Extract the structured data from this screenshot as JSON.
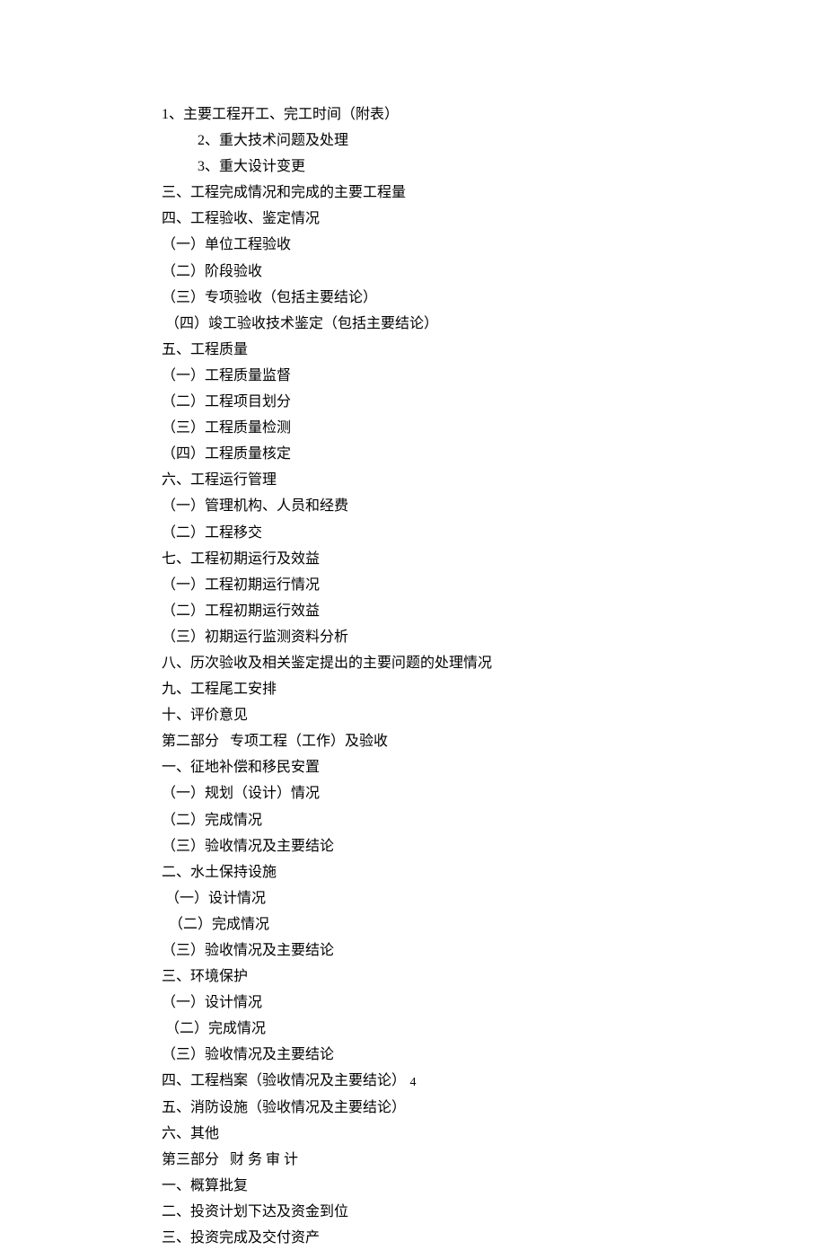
{
  "lines": [
    {
      "text": "1、主要工程开工、完工时间（附表）",
      "indent": 0
    },
    {
      "text": "2、重大技术问题及处理",
      "indent": 1
    },
    {
      "text": "3、重大设计变更",
      "indent": 1
    },
    {
      "text": "三、工程完成情况和完成的主要工程量",
      "indent": 0
    },
    {
      "text": "四、工程验收、鉴定情况",
      "indent": 0
    },
    {
      "text": "（一）单位工程验收",
      "indent": 0
    },
    {
      "text": "（二）阶段验收",
      "indent": 0
    },
    {
      "text": "（三）专项验收（包括主要结论）",
      "indent": 0
    },
    {
      "text": " （四）竣工验收技术鉴定（包括主要结论）",
      "indent": 0
    },
    {
      "text": "五、工程质量",
      "indent": 0
    },
    {
      "text": "（一）工程质量监督",
      "indent": 0
    },
    {
      "text": "（二）工程项目划分",
      "indent": 0
    },
    {
      "text": "（三）工程质量检测",
      "indent": 0
    },
    {
      "text": "（四）工程质量核定",
      "indent": 0
    },
    {
      "text": "六、工程运行管理",
      "indent": 0
    },
    {
      "text": "（一）管理机构、人员和经费",
      "indent": 0
    },
    {
      "text": "（二）工程移交",
      "indent": 0
    },
    {
      "text": "七、工程初期运行及效益",
      "indent": 0
    },
    {
      "text": "（一）工程初期运行情况",
      "indent": 0
    },
    {
      "text": "（二）工程初期运行效益",
      "indent": 0
    },
    {
      "text": "（三）初期运行监测资料分析",
      "indent": 0
    },
    {
      "text": "八、历次验收及相关鉴定提出的主要问题的处理情况",
      "indent": 0
    },
    {
      "text": "九、工程尾工安排",
      "indent": 0
    },
    {
      "text": "十、评价意见",
      "indent": 0
    },
    {
      "text": "第二部分   专项工程（工作）及验收",
      "indent": 0
    },
    {
      "text": "一、征地补偿和移民安置",
      "indent": 0
    },
    {
      "text": "（一）规划（设计）情况",
      "indent": 0
    },
    {
      "text": "（二）完成情况",
      "indent": 0
    },
    {
      "text": "（三）验收情况及主要结论",
      "indent": 0
    },
    {
      "text": "二、水土保持设施",
      "indent": 0
    },
    {
      "text": " （一）设计情况",
      "indent": 0
    },
    {
      "text": "  （二）完成情况",
      "indent": 0
    },
    {
      "text": "（三）验收情况及主要结论",
      "indent": 0
    },
    {
      "text": "三、环境保护",
      "indent": 0
    },
    {
      "text": "（一）设计情况",
      "indent": 0
    },
    {
      "text": " （二）完成情况",
      "indent": 0
    },
    {
      "text": "（三）验收情况及主要结论",
      "indent": 0
    },
    {
      "text": "四、工程档案（验收情况及主要结论）",
      "indent": 0
    },
    {
      "text": "五、消防设施（验收情况及主要结论）",
      "indent": 0
    },
    {
      "text": "六、其他",
      "indent": 0
    },
    {
      "text": "第三部分   财 务 审 计",
      "indent": 0
    },
    {
      "text": "一、概算批复",
      "indent": 0
    },
    {
      "text": "二、投资计划下达及资金到位",
      "indent": 0
    },
    {
      "text": "三、投资完成及交付资产",
      "indent": 0
    }
  ],
  "pageNumber": "4"
}
